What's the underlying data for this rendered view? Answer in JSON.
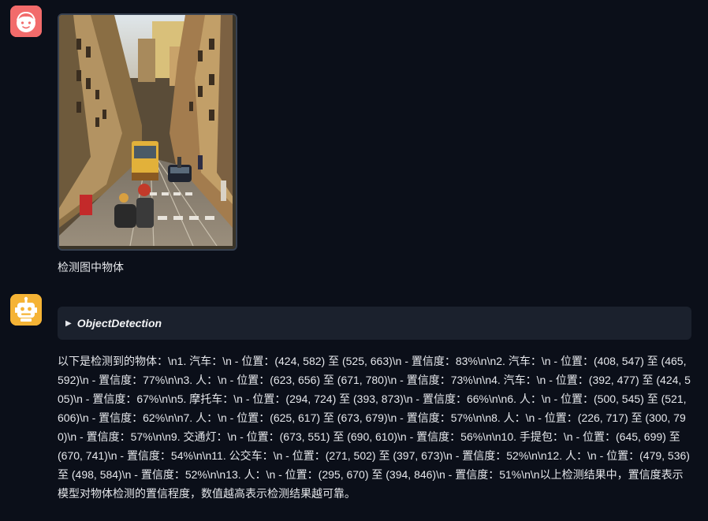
{
  "user_message": {
    "avatar_icon": "smiling-face-icon",
    "image_icon": "street-tram-photo",
    "text": "检测图中物体"
  },
  "bot_message": {
    "avatar_icon": "robot-face-icon",
    "tool_call": {
      "arrow": "▶",
      "label": "ObjectDetection"
    },
    "text": "以下是检测到的物体：\\n1. 汽车：\\n - 位置：(424, 582) 至 (525, 663)\\n - 置信度：83%\\n\\n2. 汽车：\\n - 位置：(408, 547) 至 (465, 592)\\n - 置信度：77%\\n\\n3. 人：\\n - 位置：(623, 656) 至 (671, 780)\\n - 置信度：73%\\n\\n4. 汽车：\\n - 位置：(392, 477) 至 (424, 505)\\n - 置信度：67%\\n\\n5. 摩托车：\\n - 位置：(294, 724) 至 (393, 873)\\n - 置信度：66%\\n\\n6. 人：\\n - 位置：(500, 545) 至 (521, 606)\\n - 置信度：62%\\n\\n7. 人：\\n - 位置：(625, 617) 至 (673, 679)\\n - 置信度：57%\\n\\n8. 人：\\n - 位置：(226, 717) 至 (300, 790)\\n - 置信度：57%\\n\\n9. 交通灯：\\n - 位置：(673, 551) 至 (690, 610)\\n - 置信度：56%\\n\\n10. 手提包：\\n - 位置：(645, 699) 至 (670, 741)\\n - 置信度：54%\\n\\n11. 公交车：\\n - 位置：(271, 502) 至 (397, 673)\\n - 置信度：52%\\n\\n12. 人：\\n - 位置：(479, 536) 至 (498, 584)\\n - 置信度：52%\\n\\n13. 人：\\n - 位置：(295, 670) 至 (394, 846)\\n - 置信度：51%\\n\\n以上检测结果中，置信度表示模型对物体检测的置信程度，数值越高表示检测结果越可靠。"
  }
}
